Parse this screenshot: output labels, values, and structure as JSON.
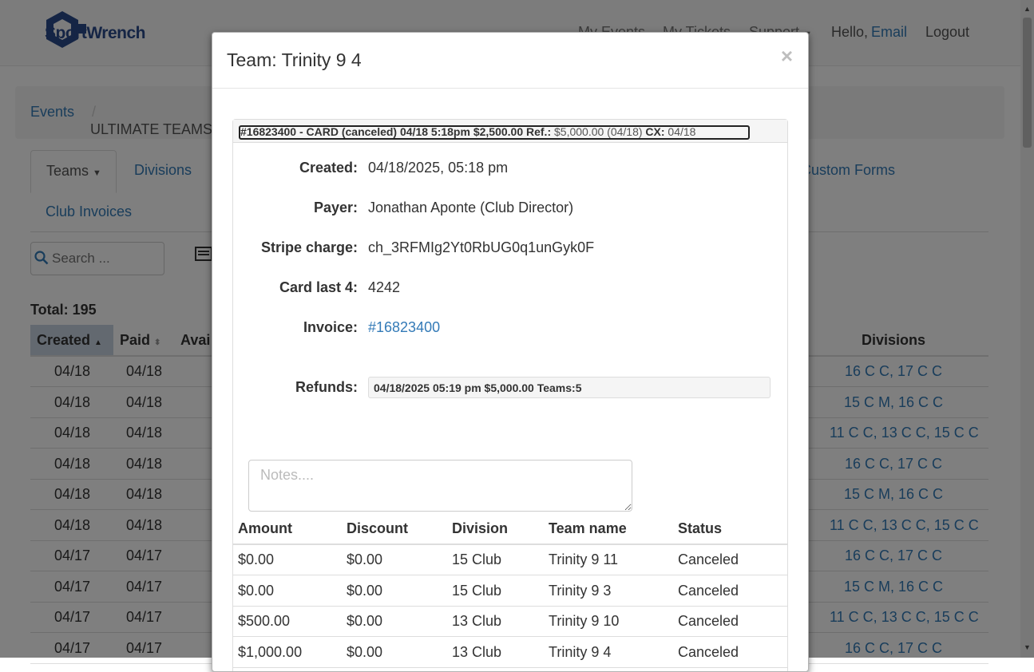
{
  "navbar": {
    "logo_text": "SportWrench",
    "links": [
      "My Events",
      "My Tickets",
      "Support"
    ],
    "greeting": "Hello,",
    "user": "Email",
    "logout": "Logout"
  },
  "breadcrumb": {
    "events": "Events",
    "separator": "/",
    "current": "ULTIMATE TEAMS"
  },
  "tabs": {
    "teams": "Teams",
    "divisions": "Divisions",
    "custom_forms": "Custom Forms",
    "club_invoices": "Club Invoices"
  },
  "search": {
    "placeholder": "Search ..."
  },
  "total": "Total: 195",
  "table": {
    "headers": {
      "created": "Created",
      "paid": "Paid",
      "avail": "Avai",
      "divisions": "Divisions"
    },
    "rows": [
      {
        "created": "04/18",
        "paid": "04/18",
        "divisions": "16 C C, 17 C C"
      },
      {
        "created": "04/18",
        "paid": "04/18",
        "divisions": "15 C M, 16 C C"
      },
      {
        "created": "04/18",
        "paid": "04/18",
        "divisions": "11 C C, 13 C C, 15 C C"
      },
      {
        "created": "04/18",
        "paid": "04/18",
        "divisions": "16 C C, 17 C C"
      },
      {
        "created": "04/18",
        "paid": "04/18",
        "divisions": "15 C M, 16 C C"
      },
      {
        "created": "04/18",
        "paid": "04/18",
        "divisions": "11 C C, 13 C C, 15 C C"
      },
      {
        "created": "04/17",
        "paid": "04/17",
        "divisions": "16 C C, 17 C C"
      },
      {
        "created": "04/17",
        "paid": "04/17",
        "divisions": "15 C M, 16 C C"
      },
      {
        "created": "04/17",
        "paid": "04/17",
        "divisions": "11 C C, 13 C C, 15 C C"
      },
      {
        "created": "04/17",
        "paid": "04/17",
        "divisions": "16 C C, 17 C C"
      }
    ]
  },
  "modal": {
    "title": "Team: Trinity 9 4",
    "close": "×",
    "payment": {
      "heading_main": "#16823400 - CARD (canceled) 04/18 5:18pm   $2,500.00   Ref.:",
      "heading_ref": " $5,000.00 (04/18)   ",
      "heading_cx_label": "CX:",
      "heading_cx_value": " 04/18",
      "labels": {
        "created": "Created:",
        "payer": "Payer:",
        "stripe": "Stripe charge:",
        "card": "Card last 4:",
        "invoice": "Invoice:",
        "refunds": "Refunds:"
      },
      "created": "04/18/2025, 05:18 pm",
      "payer": "Jonathan Aponte (Club Director)",
      "stripe": "ch_3RFMIg2Yt0RbUG0q1unGyk0F",
      "card": "4242",
      "invoice": "#16823400",
      "refund_line": "04/18/2025 05:19 pm   $5,000.00   Teams:5"
    },
    "notes_placeholder": "Notes....",
    "teams_table": {
      "headers": {
        "amount": "Amount",
        "discount": "Discount",
        "division": "Division",
        "team": "Team name",
        "status": "Status"
      },
      "rows": [
        {
          "amount": "$0.00",
          "discount": "$0.00",
          "division": "15 Club",
          "team": "Trinity 9 11",
          "status": "Canceled"
        },
        {
          "amount": "$0.00",
          "discount": "$0.00",
          "division": "15 Club",
          "team": "Trinity 9 3",
          "status": "Canceled"
        },
        {
          "amount": "$500.00",
          "discount": "$0.00",
          "division": "13 Club",
          "team": "Trinity 9 10",
          "status": "Canceled"
        },
        {
          "amount": "$1,000.00",
          "discount": "$0.00",
          "division": "13 Club",
          "team": "Trinity 9 4",
          "status": "Canceled"
        }
      ]
    }
  },
  "colors": {
    "link": "#337ab7",
    "sorted_header": "#c7d3e0",
    "overlay": "rgba(0,0,0,0.5)"
  }
}
